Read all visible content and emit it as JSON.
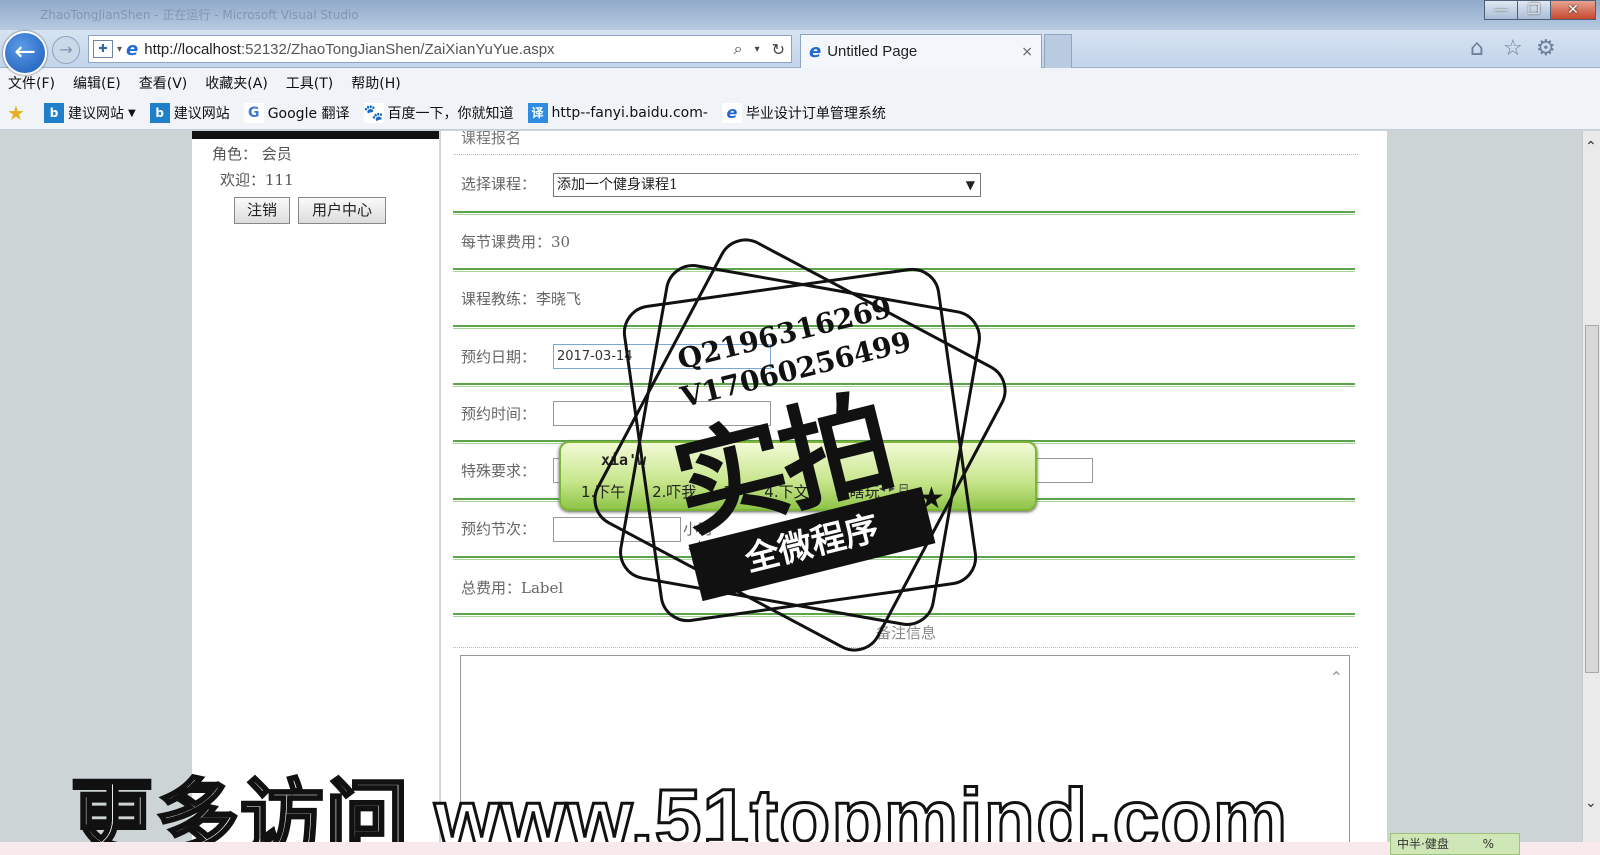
{
  "browser": {
    "title_ghost": "ZhaoTongJianShen - 正在运行 - Microsoft Visual Studio",
    "window_buttons": [
      "—",
      "❐",
      "✕"
    ],
    "address": {
      "host": "http://localhost",
      "rest": ":52132/ZhaoTongJianShen/ZaiXianYuYue.aspx"
    },
    "tab_title": "Untitled Page",
    "tab_close": "×",
    "menu": [
      "文件(F)",
      "编辑(E)",
      "查看(V)",
      "收藏夹(A)",
      "工具(T)",
      "帮助(H)"
    ],
    "favorites": [
      {
        "label": "建议网站",
        "icon": "bing-icon",
        "dropdown": true
      },
      {
        "label": "建议网站",
        "icon": "bing-icon",
        "dropdown": false
      },
      {
        "label": "Google 翻译",
        "icon": "google-translate-icon",
        "dropdown": false
      },
      {
        "label": "百度一下，你就知道",
        "icon": "baidu-paw-icon",
        "dropdown": false
      },
      {
        "label": "http--fanyi.baidu.com-",
        "icon": "translate-icon",
        "dropdown": false
      },
      {
        "label": "毕业设计订单管理系统",
        "icon": "ie-icon",
        "dropdown": false
      }
    ]
  },
  "sidebar": {
    "role": "角色：  会员",
    "welcome": "欢迎：111",
    "logout_label": "注销",
    "user_center_label": "用户中心"
  },
  "form": {
    "section_title": "课程报名",
    "course_label": "选择课程：",
    "course_value": "添加一个健身课程1",
    "fee_text": "每节课费用：30",
    "coach_text": "课程教练：李晓飞",
    "date_label": "预约日期：",
    "date_value": "2017-03-14",
    "time_label": "预约时间：",
    "time_value": "",
    "special_label": "特殊要求：",
    "special_value": "",
    "sessions_label": "预约节次：",
    "sessions_value": "",
    "sessions_unit": "小时",
    "total_text": "总费用：Label",
    "remark_title": "备注信息"
  },
  "ime": {
    "composition": "xia'w",
    "candidates": [
      "1.下午",
      "2.吓我",
      "3.",
      "4.下文",
      "5.瞎玩"
    ],
    "pager": "◂ ▸ ⊟"
  },
  "watermark": {
    "line1": "Q2196316269",
    "line2": "V17060256499",
    "big": "实拍",
    "ribbon": "全微程序",
    "footer": "更多访问 www.51topmind.com"
  },
  "statusbar": {
    "ime_status": "中半·健盘",
    "zoom": "%"
  }
}
